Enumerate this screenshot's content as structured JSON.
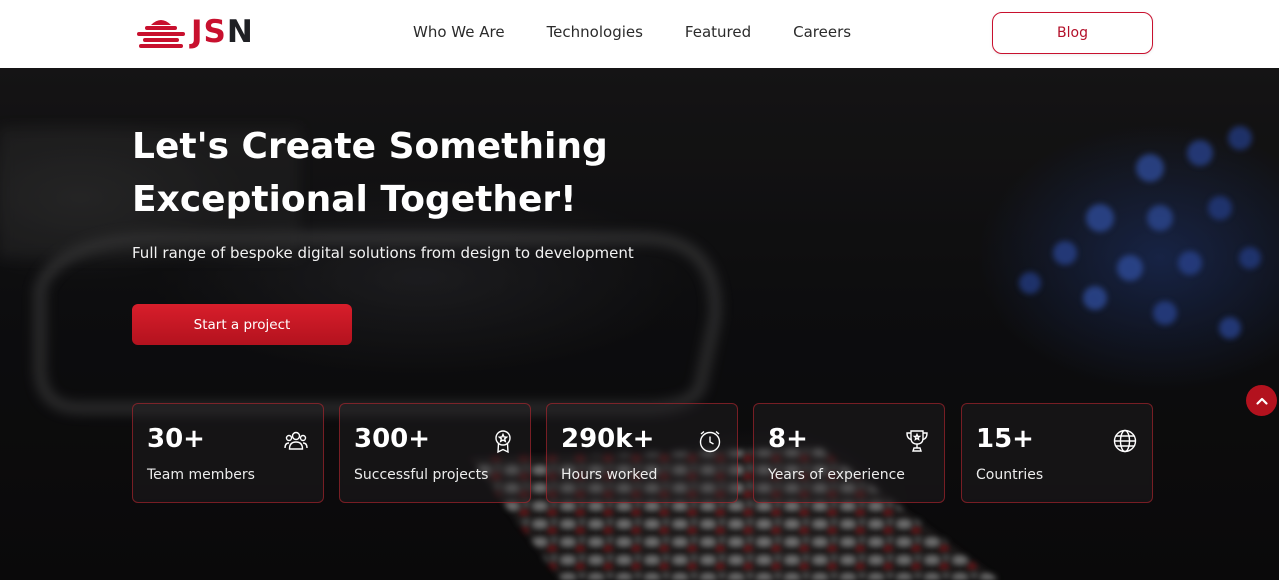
{
  "brand": {
    "logo_text_red": "JS",
    "logo_text_dark": "N",
    "accent": "#c8102e"
  },
  "nav": {
    "items": [
      {
        "label": "Who We Are"
      },
      {
        "label": "Technologies"
      },
      {
        "label": "Featured"
      },
      {
        "label": "Careers"
      }
    ],
    "blog_label": "Blog"
  },
  "hero": {
    "title": "Let's Create Something Exceptional Together!",
    "subtitle": "Full range of bespoke digital solutions from design to development",
    "cta_label": "Start a project"
  },
  "stats": [
    {
      "value": "30+",
      "label": "Team members",
      "icon": "team-icon"
    },
    {
      "value": "300+",
      "label": "Successful projects",
      "icon": "award-icon"
    },
    {
      "value": "290k+",
      "label": "Hours worked",
      "icon": "clock-icon"
    },
    {
      "value": "8+",
      "label": "Years of experience",
      "icon": "trophy-icon"
    },
    {
      "value": "15+",
      "label": "Countries",
      "icon": "globe-icon"
    }
  ],
  "scroll_top": {
    "icon": "chevron-up-icon"
  }
}
